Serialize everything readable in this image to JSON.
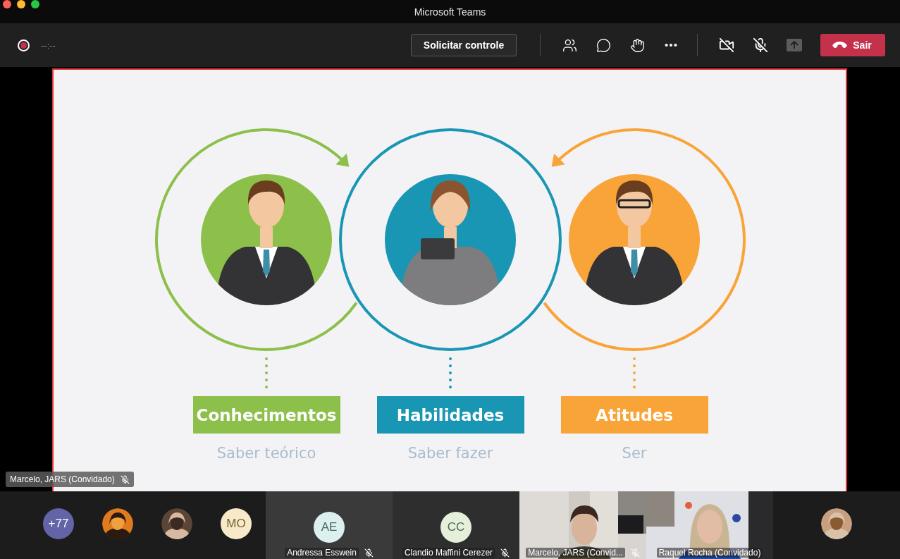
{
  "window": {
    "title": "Microsoft Teams"
  },
  "toolbar": {
    "recording_timer": "--:--",
    "request_control": "Solicitar controle",
    "camera_on": false,
    "mic_on": false,
    "share_enabled": false,
    "leave": "Sair"
  },
  "slide": {
    "columns": [
      {
        "title": "Conhecimentos",
        "subtitle": "Saber teórico",
        "color": "#8cc04b",
        "kind": "man"
      },
      {
        "title": "Habilidades",
        "subtitle": "Saber fazer",
        "color": "#1996b4",
        "kind": "woman"
      },
      {
        "title": "Atitudes",
        "subtitle": "Ser",
        "color": "#f9a438",
        "kind": "glasses"
      }
    ]
  },
  "presenter_label": {
    "name": "Marcelo, JARS (Convidado)",
    "muted": true
  },
  "gallery": {
    "overflow_count": "+77",
    "participants": [
      {
        "kind": "picture"
      },
      {
        "kind": "picture"
      },
      {
        "kind": "initials",
        "initials": "MO",
        "color": "#f8e9c9"
      },
      {
        "kind": "tile",
        "initials": "AE",
        "color": "#dcf0f0",
        "name": "Andressa Esswein",
        "muted": true
      },
      {
        "kind": "tile",
        "initials": "CC",
        "color": "#e6efd9",
        "name": "Clandio Maffini Cerezer",
        "muted": true
      },
      {
        "kind": "video",
        "name": "Marcelo, JARS (Convid...",
        "muted": true
      },
      {
        "kind": "video",
        "name": "Raquel Rocha (Convidado)",
        "muted": false
      },
      {
        "kind": "picture"
      }
    ]
  }
}
